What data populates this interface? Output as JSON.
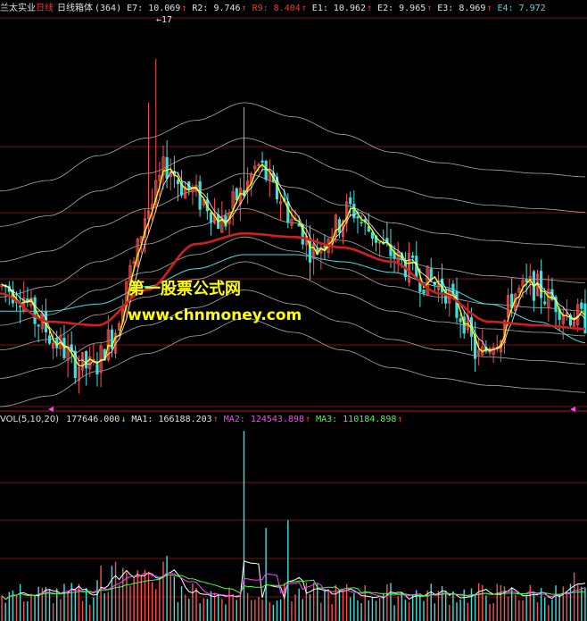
{
  "header": {
    "stock_name": "兰太实业",
    "period": "日线",
    "indicator": "日线箱体",
    "bar_count": "(364)",
    "values": [
      {
        "label": "E7:",
        "value": "10.069",
        "arrow": "↑",
        "color": "#e0e0e0"
      },
      {
        "label": "R2:",
        "value": "9.746",
        "arrow": "↑",
        "color": "#e0e0e0"
      },
      {
        "label": "R9:",
        "value": "8.404",
        "arrow": "↑",
        "color": "#ff3030"
      },
      {
        "label": "E1:",
        "value": "10.962",
        "arrow": "↑",
        "color": "#e0e0e0"
      },
      {
        "label": "E2:",
        "value": "9.965",
        "arrow": "↑",
        "color": "#e0e0e0"
      },
      {
        "label": "E3:",
        "value": "8.969",
        "arrow": "↑",
        "color": "#e0e0e0"
      },
      {
        "label": "E4:",
        "value": "7.972",
        "arrow": "",
        "color": "#40e0e0"
      }
    ]
  },
  "price_panel": {
    "peak_label": "17",
    "colors": {
      "up": "#ff5050",
      "down": "#40e0e0",
      "fast_ma": "#ffff00",
      "slow_ma": "#d21e1e",
      "band": "#c8c8c8",
      "band_mid": "#40e0e0",
      "grid": "#7a1010"
    }
  },
  "volume_panel": {
    "label": "VOL(5,10,20)",
    "items": [
      {
        "text": "177646.000",
        "arrow": "↓",
        "color": "#e0e0e0"
      },
      {
        "text": "MA1: 166188.203",
        "arrow": "↑",
        "color": "#e0e0e0"
      },
      {
        "text": "MA2: 124543.898",
        "arrow": "↑",
        "color": "#ff40ff"
      },
      {
        "text": "MA3: 110184.898",
        "arrow": "↑",
        "color": "#40ff40"
      }
    ]
  },
  "watermark": {
    "line1": "第一股票公式网",
    "line2": "www.chnmoney.com"
  },
  "chart_data": {
    "type": "line",
    "y_range": [
      6.2,
      17.2
    ],
    "series": [
      {
        "name": "E1",
        "values": [
          11.0,
          11.3,
          11.9,
          12.6,
          13.2,
          13.6,
          13.5,
          13.1,
          12.6,
          12.2,
          11.8,
          11.5,
          11.2
        ]
      },
      {
        "name": "R2",
        "values": [
          9.3,
          9.6,
          10.3,
          10.8,
          11.3,
          11.8,
          11.4,
          10.9,
          10.4,
          10.1,
          9.9,
          9.8,
          9.7
        ]
      },
      {
        "name": "E4",
        "values": [
          8.9,
          8.9,
          9.1,
          9.6,
          10.1,
          10.5,
          10.5,
          10.3,
          10.0,
          9.6,
          9.1,
          8.6,
          8.0
        ]
      },
      {
        "name": "R9",
        "values": [
          9.4,
          8.6,
          8.5,
          9.5,
          10.8,
          11.1,
          11.0,
          10.7,
          10.3,
          9.4,
          8.6,
          8.5,
          8.4
        ]
      }
    ]
  }
}
